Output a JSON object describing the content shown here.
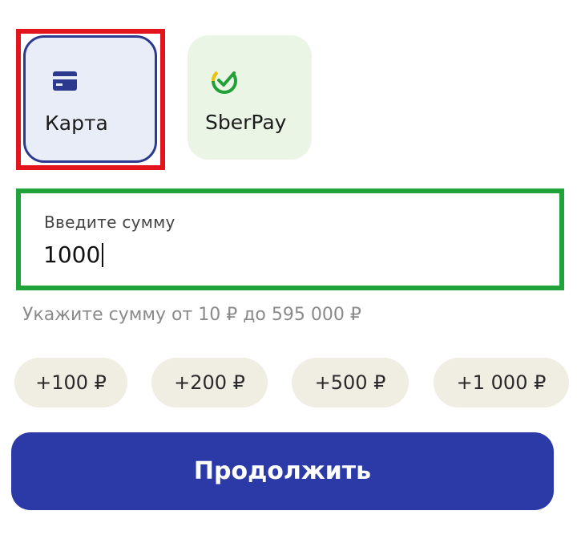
{
  "payment_methods": [
    {
      "label": "Карта",
      "icon": "credit-card-icon",
      "selected": true
    },
    {
      "label": "SberPay",
      "icon": "sberpay-logo-icon",
      "selected": false
    }
  ],
  "amount": {
    "label": "Введите сумму",
    "value": "1000"
  },
  "hint": "Укажите сумму от 10 ₽ до 595 000 ₽",
  "quick_add": [
    "+100 ₽",
    "+200 ₽",
    "+500 ₽",
    "+1 000 ₽"
  ],
  "continue_label": "Продолжить",
  "colors": {
    "accent": "#2b3aa6",
    "card_selected_bg": "#e9edf8",
    "sber_bg": "#ebf5e6",
    "chip_bg": "#f0ede3",
    "highlight_red": "#e3141d",
    "highlight_green": "#1fa33a"
  }
}
